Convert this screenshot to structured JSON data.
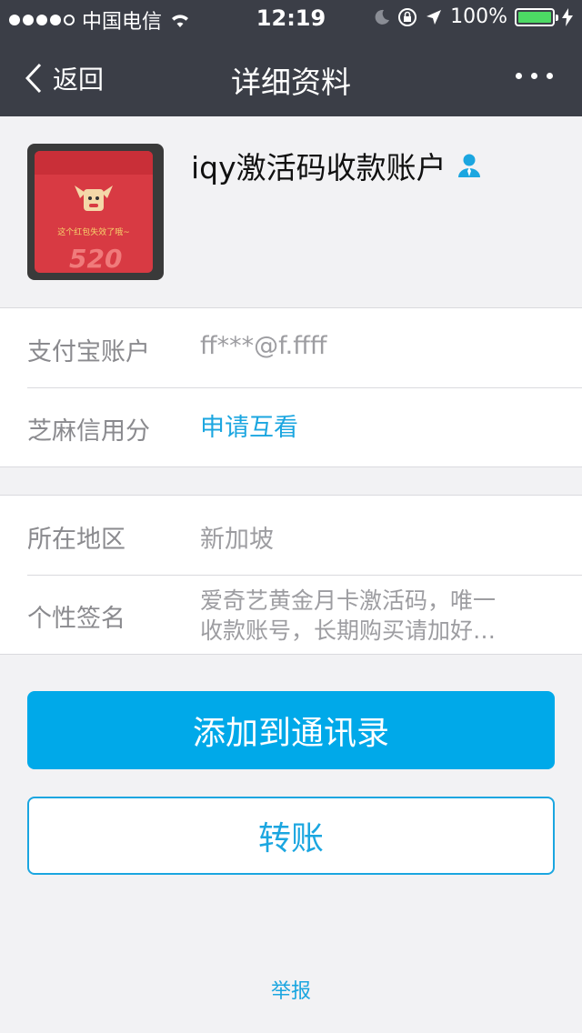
{
  "status_bar": {
    "carrier": "中国电信",
    "time": "12:19",
    "battery": "100%",
    "icons": [
      "signal-dots",
      "wifi-icon",
      "moon-icon",
      "rotation-lock-icon",
      "location-arrow-icon",
      "battery-icon",
      "charging-bolt-icon"
    ]
  },
  "nav": {
    "back_label": "返回",
    "title": "详细资料",
    "more_icon": "more-dots-icon"
  },
  "profile": {
    "name": "iqy激活码收款账户",
    "avatar_text": "这个红包失效了哦~",
    "avatar_number": "520"
  },
  "account_group": [
    {
      "label": "支付宝账户",
      "value": "ff***@f.ffff"
    },
    {
      "label": "芝麻信用分",
      "value": "申请互看"
    }
  ],
  "info_group": [
    {
      "label": "所在地区",
      "value": "新加坡"
    },
    {
      "label": "个性签名",
      "value_line1": "爱奇艺黄金月卡激活码，唯一",
      "value_line2": "收款账号，长期购买请加好…"
    }
  ],
  "buttons": {
    "add_contact": "添加到通讯录",
    "transfer": "转账"
  },
  "footer": {
    "report": "举报"
  },
  "colors": {
    "header_bg": "#3b3e47",
    "accent": "#00a9e9",
    "link": "#1ba6e0",
    "battery": "#4cd964"
  }
}
